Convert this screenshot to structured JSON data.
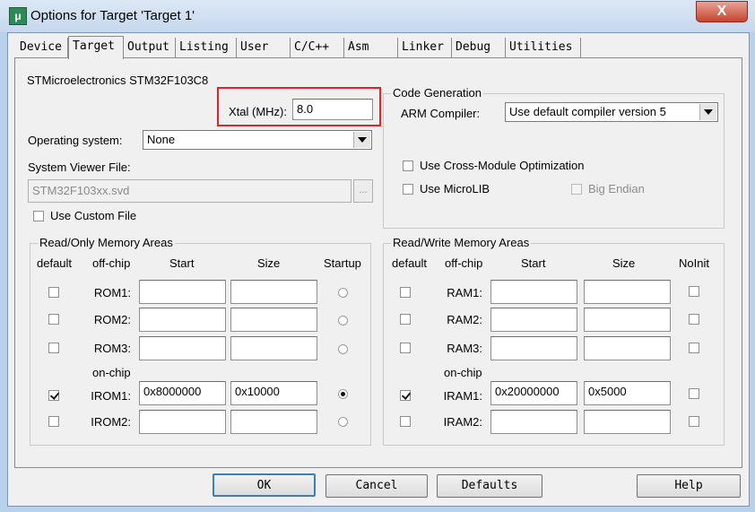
{
  "window": {
    "title": "Options for Target 'Target 1'",
    "close_label": "X"
  },
  "tabs": [
    {
      "label": "Device"
    },
    {
      "label": "Target"
    },
    {
      "label": "Output"
    },
    {
      "label": "Listing"
    },
    {
      "label": "User"
    },
    {
      "label": "C/C++"
    },
    {
      "label": "Asm"
    },
    {
      "label": "Linker"
    },
    {
      "label": "Debug"
    },
    {
      "label": "Utilities"
    }
  ],
  "target": {
    "device_name": "STMicroelectronics STM32F103C8",
    "xtal_label": "Xtal (MHz):",
    "xtal_value": "8.0",
    "os_label": "Operating system:",
    "os_value": "None",
    "svd_label": "System Viewer File:",
    "svd_value": "STM32F103xx.svd",
    "svd_browse": "...",
    "custom_file_label": "Use Custom File"
  },
  "code_generation": {
    "title": "Code Generation",
    "compiler_label": "ARM Compiler:",
    "compiler_value": "Use default compiler version 5",
    "cross_module_label": "Use Cross-Module Optimization",
    "microlib_label": "Use MicroLIB",
    "big_endian_label": "Big Endian"
  },
  "ro_memory": {
    "title": "Read/Only Memory Areas",
    "headers": {
      "default": "default",
      "offchip": "off-chip",
      "start": "Start",
      "size": "Size",
      "startup": "Startup"
    },
    "onchip_label": "on-chip",
    "rows": [
      {
        "name": "ROM1:",
        "start": "",
        "size": "",
        "default": false,
        "startup": false
      },
      {
        "name": "ROM2:",
        "start": "",
        "size": "",
        "default": false,
        "startup": false
      },
      {
        "name": "ROM3:",
        "start": "",
        "size": "",
        "default": false,
        "startup": false
      },
      {
        "name": "IROM1:",
        "start": "0x8000000",
        "size": "0x10000",
        "default": true,
        "startup": true
      },
      {
        "name": "IROM2:",
        "start": "",
        "size": "",
        "default": false,
        "startup": false
      }
    ]
  },
  "rw_memory": {
    "title": "Read/Write Memory Areas",
    "headers": {
      "default": "default",
      "offchip": "off-chip",
      "start": "Start",
      "size": "Size",
      "noinit": "NoInit"
    },
    "onchip_label": "on-chip",
    "rows": [
      {
        "name": "RAM1:",
        "start": "",
        "size": "",
        "default": false,
        "noinit": false
      },
      {
        "name": "RAM2:",
        "start": "",
        "size": "",
        "default": false,
        "noinit": false
      },
      {
        "name": "RAM3:",
        "start": "",
        "size": "",
        "default": false,
        "noinit": false
      },
      {
        "name": "IRAM1:",
        "start": "0x20000000",
        "size": "0x5000",
        "default": true,
        "noinit": false
      },
      {
        "name": "IRAM2:",
        "start": "",
        "size": "",
        "default": false,
        "noinit": false
      }
    ]
  },
  "buttons": {
    "ok": "OK",
    "cancel": "Cancel",
    "defaults": "Defaults",
    "help": "Help"
  },
  "colors": {
    "highlight": "#e0242b",
    "title_bar": "#c6d8ee",
    "close_button": "#c7432f"
  }
}
